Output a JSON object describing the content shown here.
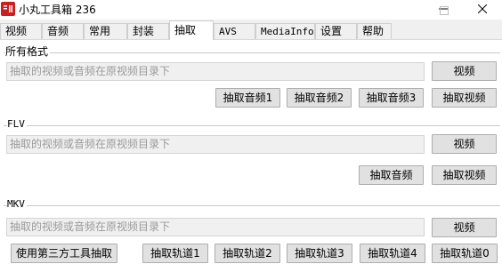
{
  "window": {
    "title": "小丸工具箱 236",
    "minimize_icon": "minimize-icon",
    "maximize_icon": "maximize-icon",
    "close_icon": "close-icon"
  },
  "tabs": [
    {
      "label": "视频"
    },
    {
      "label": "音频"
    },
    {
      "label": "常用"
    },
    {
      "label": "封装"
    },
    {
      "label": "抽取",
      "active": true
    },
    {
      "label": "AVS"
    },
    {
      "label": "MediaInfo"
    },
    {
      "label": "设置"
    },
    {
      "label": "帮助"
    }
  ],
  "sections": {
    "all": {
      "label": "所有格式",
      "path_placeholder": "抽取的视频或音频在原视频目录下",
      "browse_label": "视频",
      "buttons": [
        "抽取音频1",
        "抽取音频2",
        "抽取音频3",
        "抽取视频"
      ]
    },
    "flv": {
      "label": "FLV",
      "path_placeholder": "抽取的视频或音频在原视频目录下",
      "browse_label": "视频",
      "buttons": [
        "抽取音频",
        "抽取视频"
      ]
    },
    "mkv": {
      "label": "MKV",
      "path_placeholder": "抽取的视频或音频在原视频目录下",
      "browse_label": "视频",
      "third_party_label": "使用第三方工具抽取",
      "buttons": [
        "抽取轨道1",
        "抽取轨道2",
        "抽取轨道3",
        "抽取轨道4",
        "抽取轨道0"
      ]
    }
  }
}
